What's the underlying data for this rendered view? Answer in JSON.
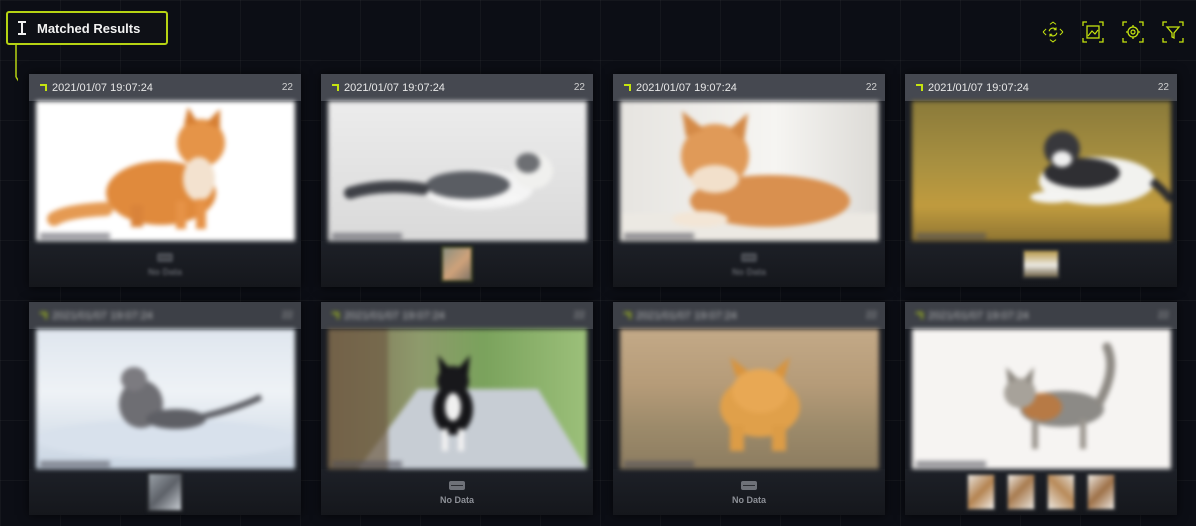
{
  "header": {
    "title": "Matched Results",
    "title_icon": "hourglass-icon",
    "accent_color": "#b6d313"
  },
  "toolbar": {
    "buttons": [
      {
        "name": "refresh-icon"
      },
      {
        "name": "image-icon"
      },
      {
        "name": "settings-icon"
      },
      {
        "name": "filter-icon"
      }
    ]
  },
  "cards": [
    {
      "timestamp": "2021/01/07 19:07:24",
      "count": "22",
      "footer": "nodata",
      "nodata_label": "No Data"
    },
    {
      "timestamp": "2021/01/07 19:07:24",
      "count": "22",
      "footer": "thumbs",
      "thumb_count": 1
    },
    {
      "timestamp": "2021/01/07 19:07:24",
      "count": "22",
      "footer": "nodata",
      "nodata_label": "No Data"
    },
    {
      "timestamp": "2021/01/07 19:07:24",
      "count": "22",
      "footer": "thumbs",
      "thumb_count": 1
    },
    {
      "timestamp": "2021/01/07 19:07:24",
      "count": "22",
      "footer": "thumbs",
      "thumb_count": 1
    },
    {
      "timestamp": "2021/01/07 19:07:24",
      "count": "22",
      "footer": "nodata",
      "nodata_label": "No Data"
    },
    {
      "timestamp": "2021/01/07 19:07:24",
      "count": "22",
      "footer": "nodata",
      "nodata_label": "No Data"
    },
    {
      "timestamp": "2021/01/07 19:07:24",
      "count": "22",
      "footer": "thumbs",
      "thumb_count": 4
    }
  ]
}
